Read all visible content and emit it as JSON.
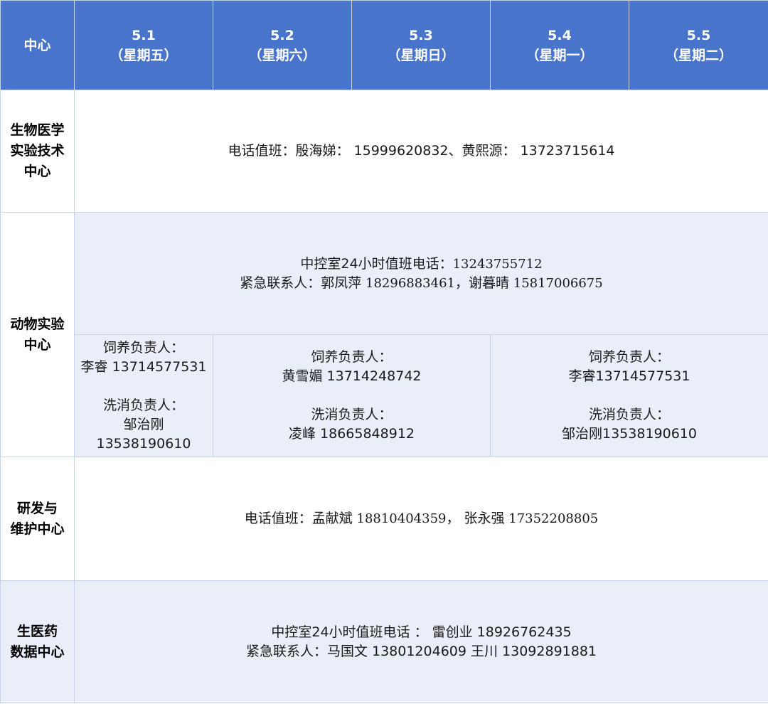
{
  "header": {
    "center_label": "中心",
    "days": [
      {
        "date": "5.1",
        "weekday": "（星期五）"
      },
      {
        "date": "5.2",
        "weekday": "（星期六）"
      },
      {
        "date": "5.3",
        "weekday": "（星期日）"
      },
      {
        "date": "5.4",
        "weekday": "（星期一）"
      },
      {
        "date": "5.5",
        "weekday": "（星期二）"
      }
    ]
  },
  "rows": {
    "bio_tech": {
      "name_lines": [
        "生物医学",
        "实验技术",
        "中心"
      ],
      "text": "电话值班：殷海娣： 15999620832、黄熙源： 13723715614"
    },
    "animal": {
      "name_lines": [
        "动物实验",
        "中心"
      ],
      "control_label": "中控室24小时值班电话：",
      "control_phone": "13243755712",
      "emergency_label": "紧急联系人：郭凤萍",
      "emergency_phone1": " 18296883461",
      "emergency_sep": "，谢暮晴",
      "emergency_phone2": " 15817006675",
      "shift1": {
        "feed_label": "饲养负责人：",
        "feed_person": "李睿 13714577531",
        "wash_label": "洗消负责人：",
        "wash_person": "邹治刚",
        "wash_phone": "13538190610"
      },
      "shift2": {
        "feed_label": "饲养负责人：",
        "feed_person": "黄雪媚 13714248742",
        "wash_label": "洗消负责人：",
        "wash_person": "凌峰 18665848912"
      },
      "shift3": {
        "feed_label": "饲养负责人：",
        "feed_person": "李睿13714577531",
        "wash_label": "洗消负责人：",
        "wash_person": "邹治刚13538190610"
      }
    },
    "rnd": {
      "name_lines": [
        "研发与",
        "维护中心"
      ],
      "prefix": "电话值班：孟献斌",
      "phone1": " 18810404359",
      "sep": "， 张永强",
      "phone2": " 17352208805"
    },
    "pharma": {
      "name_lines": [
        "生医药",
        "数据中心"
      ],
      "line1": "中控室24小时值班电话 ： 雷创业 18926762435",
      "line2": "紧急联系人：马国文 13801204609  王川 13092891881"
    }
  }
}
